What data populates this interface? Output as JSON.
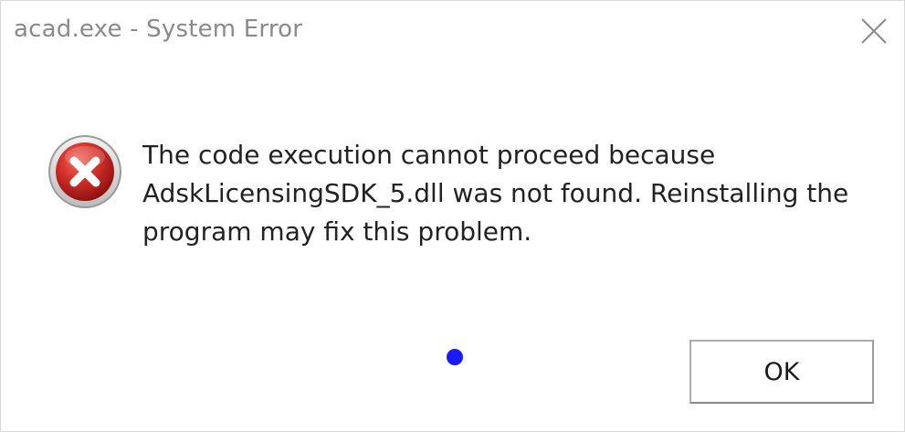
{
  "window": {
    "title": "acad.exe - System Error"
  },
  "icons": {
    "close": "close-icon",
    "error": "error-icon"
  },
  "message": {
    "lines": [
      "The code execution cannot proceed because",
      "AdskLicensingSDK_5.dll was not found. Reinstalling the",
      "program may fix this problem."
    ]
  },
  "buttons": {
    "ok_label": "OK"
  },
  "colors": {
    "error_red": "#c1272d",
    "cursor_dot": "#1a1aff",
    "title_gray": "#8a8a8a"
  }
}
